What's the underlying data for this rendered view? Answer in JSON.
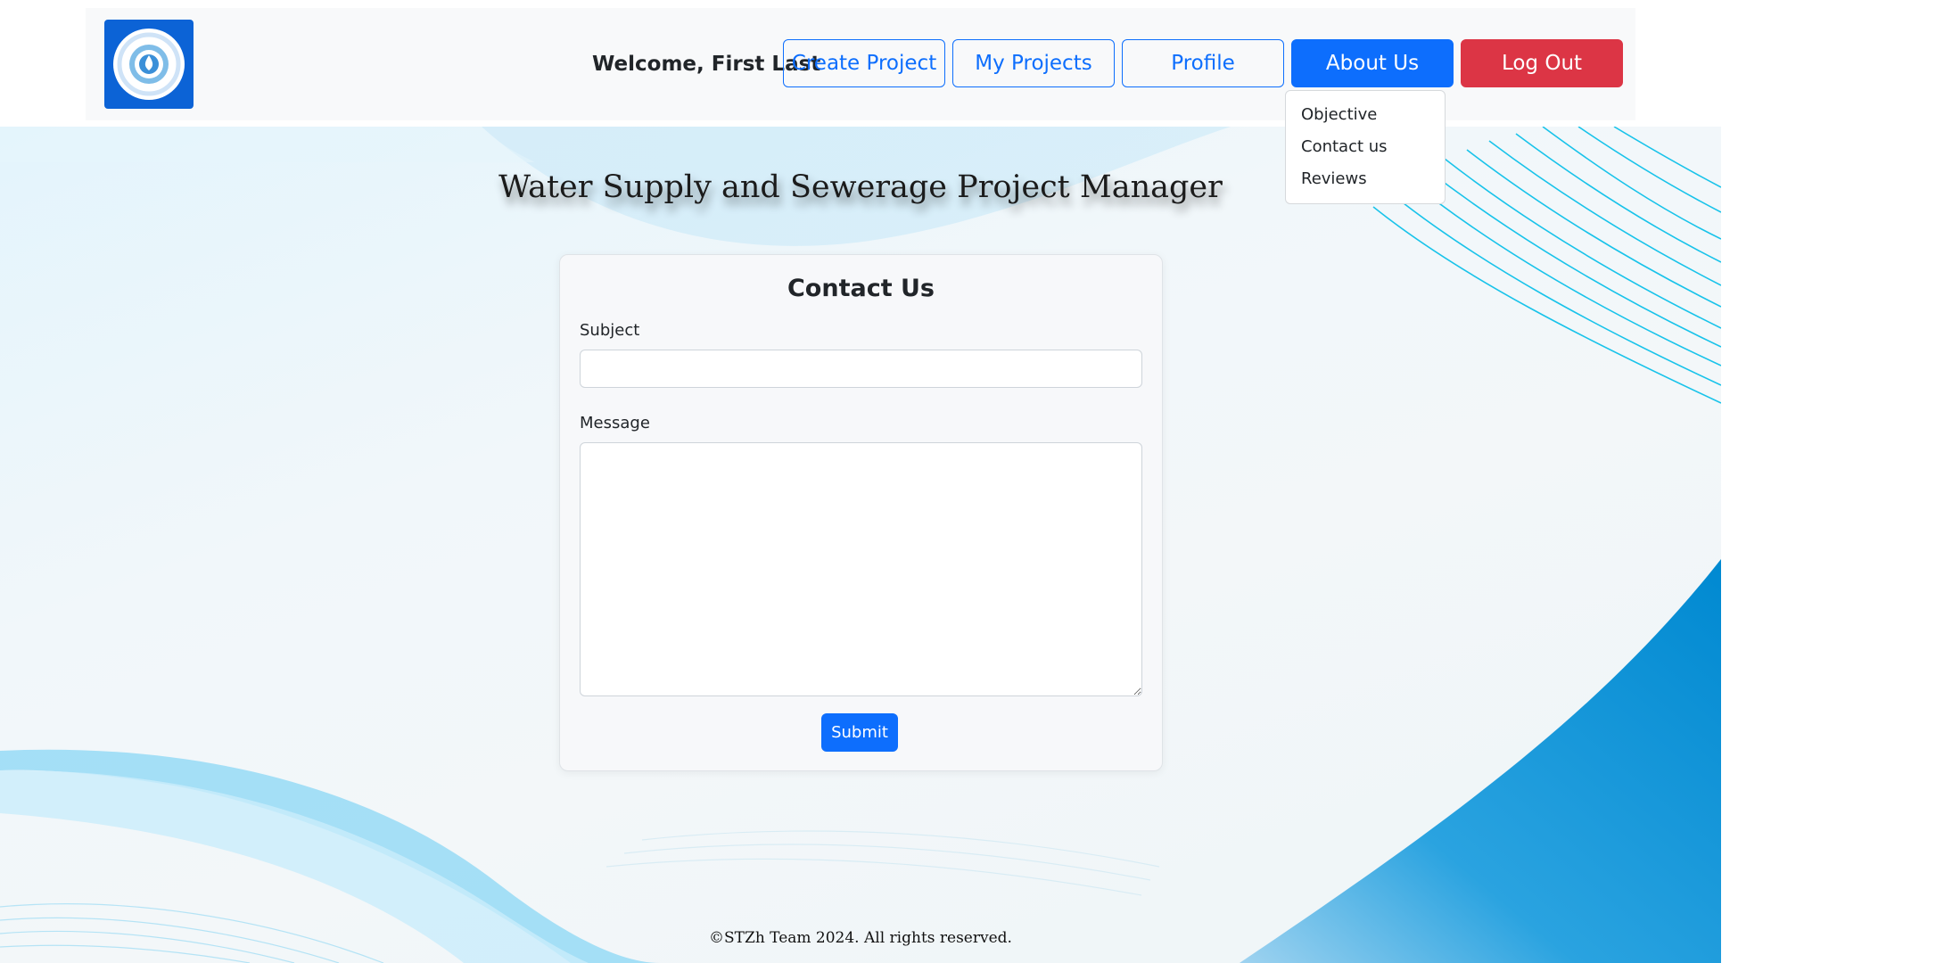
{
  "header": {
    "logo_alt": "Water Supply and Sewerage Project Manager",
    "welcome_text": "Welcome, First Last",
    "nav": {
      "create_project": "Create Project",
      "my_projects": "My Projects",
      "profile": "Profile",
      "about_us": "About Us",
      "log_out": "Log Out"
    }
  },
  "about_dropdown": {
    "items": [
      "Objective",
      "Contact us",
      "Reviews"
    ]
  },
  "page_title": "Water Supply and Sewerage Project Manager",
  "contact_form": {
    "title": "Contact Us",
    "subject_label": "Subject",
    "subject_value": "",
    "message_label": "Message",
    "message_value": "",
    "submit_label": "Submit"
  },
  "footer": {
    "text": "©STZh Team 2024. All rights reserved."
  },
  "colors": {
    "primary": "#0d6efd",
    "danger": "#dc3545",
    "navbar_bg": "#f8f9fa",
    "background_accent": "#0094d8"
  }
}
